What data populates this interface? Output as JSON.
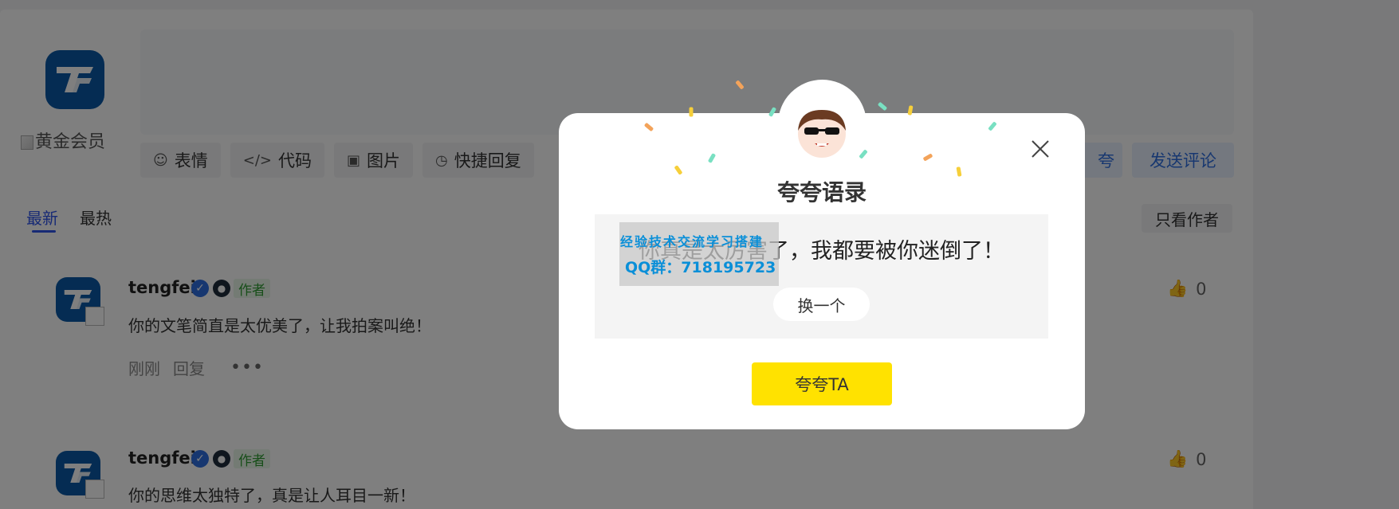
{
  "profile": {
    "vip_alt": "黄金会员"
  },
  "composer": {
    "tools": [
      {
        "icon": "smile-icon",
        "label": "表情"
      },
      {
        "icon": "code-icon",
        "label": "代码"
      },
      {
        "icon": "image-icon",
        "label": "图片"
      },
      {
        "icon": "quick-reply-icon",
        "label": "快捷回复"
      }
    ],
    "praise_label": "夸",
    "send_label": "发送评论"
  },
  "tabs": {
    "newest": "最新",
    "hottest": "最热"
  },
  "filter": {
    "author_only": "只看作者"
  },
  "comments": [
    {
      "name": "tengfei",
      "tag": "作者",
      "text": "你的文笔简直是太优美了，让我拍案叫绝！",
      "time": "刚刚",
      "reply": "回复",
      "likes": "0"
    },
    {
      "name": "tengfei",
      "tag": "作者",
      "text": "你的思维太独特了，真是让人耳目一新！",
      "likes": "0"
    }
  ],
  "modal": {
    "title": "夸夸语录",
    "quote": "你真是太厉害了，我都要被你迷倒了！",
    "swap_label": "换一个",
    "confirm_label": "夸夸TA"
  },
  "watermark": {
    "line1": "经验技术交流学习搭建",
    "line2": "QQ群：718195723"
  },
  "colors": {
    "accent": "#2f54eb",
    "confirm_yellow": "#ffe200",
    "logo_blue": "#0b58a6",
    "author_tag_green": "#2e9d33"
  }
}
